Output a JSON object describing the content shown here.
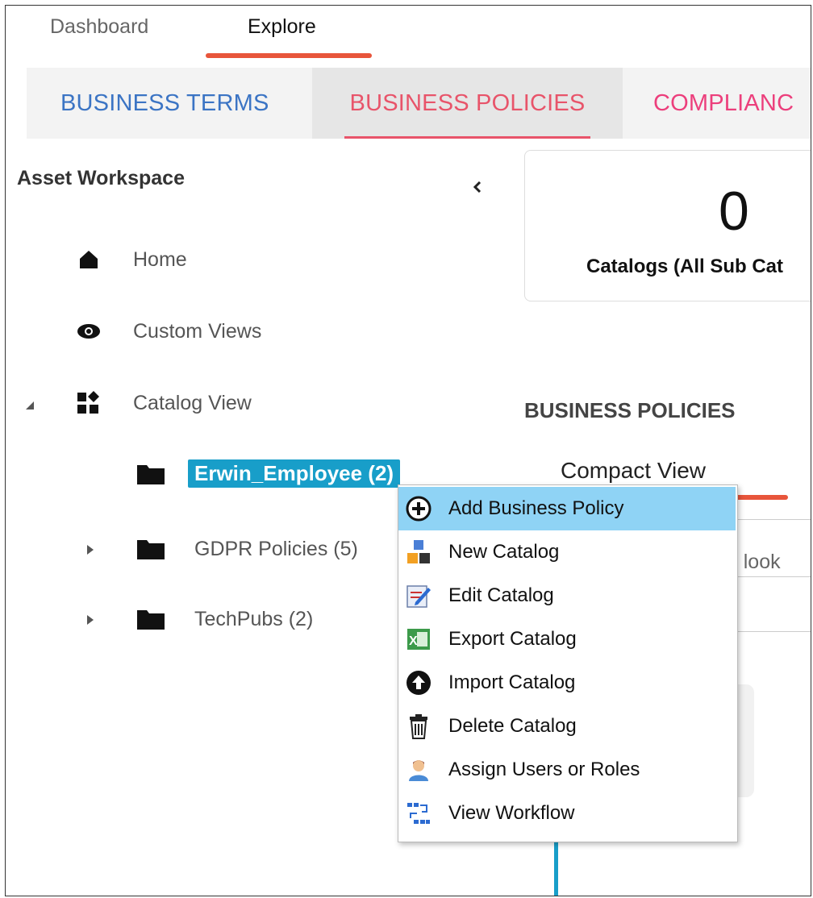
{
  "topnav": {
    "tabs": [
      {
        "label": "Dashboard"
      },
      {
        "label": "Explore"
      }
    ]
  },
  "asset_tabs": {
    "terms": "BUSINESS TERMS",
    "policies": "BUSINESS POLICIES",
    "compliance": "COMPLIANC"
  },
  "sidebar": {
    "title": "Asset Workspace",
    "items": [
      {
        "label": "Home"
      },
      {
        "label": "Custom Views"
      },
      {
        "label": "Catalog View"
      }
    ],
    "catalogs": [
      {
        "label": "Erwin_Employee (2)"
      },
      {
        "label": "GDPR Policies (5)"
      },
      {
        "label": "TechPubs (2)"
      }
    ]
  },
  "main": {
    "stat_value": "0",
    "stat_label": "Catalogs (All Sub Cat",
    "section_title": "BUSINESS POLICIES",
    "view_tab": "Compact View",
    "search_placeholder": "ou look"
  },
  "context_menu": {
    "items": [
      {
        "label": "Add Business Policy",
        "icon": "add-circle-icon"
      },
      {
        "label": "New Catalog",
        "icon": "new-catalog-icon"
      },
      {
        "label": "Edit Catalog",
        "icon": "edit-icon"
      },
      {
        "label": "Export Catalog",
        "icon": "excel-export-icon"
      },
      {
        "label": "Import Catalog",
        "icon": "import-upload-icon"
      },
      {
        "label": "Delete Catalog",
        "icon": "trash-icon"
      },
      {
        "label": "Assign Users or Roles",
        "icon": "user-icon"
      },
      {
        "label": "View Workflow",
        "icon": "workflow-icon"
      }
    ]
  },
  "colors": {
    "accent": "#e8553b",
    "selection": "#189ec9",
    "menu_highlight": "#8fd3f5",
    "terms_blue": "#3b74c4",
    "policies_pink": "#e8546a"
  }
}
